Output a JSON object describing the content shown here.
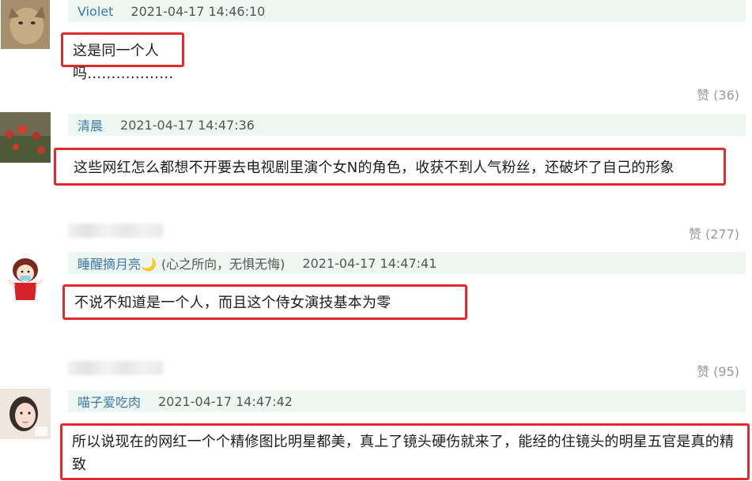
{
  "comments": [
    {
      "name": "Violet",
      "time": "2021-04-17 14:46:10",
      "text": "这是同一个人吗……………… ",
      "likes": "赞 (36)"
    },
    {
      "name": "清晨",
      "time": "2021-04-17 14:47:36",
      "text": "这些网红怎么都想不开要去电视剧里演个女N的角色，收获不到人气粉丝，还破坏了自己的形象",
      "likes": "赞 (277)"
    },
    {
      "name": "睡醒摘月亮🌙",
      "subtitle": "(心之所向，无惧无悔)",
      "time": "2021-04-17 14:47:41",
      "text": "不说不知道是一个人，而且这个侍女演技基本为零",
      "likes": "赞 (95)"
    },
    {
      "name": "喵子爱吃肉",
      "time": "2021-04-17 14:47:42",
      "text": "所以说现在的网红一个个精修图比明星都美，真上了镜头硬伤就来了，能经的住镜头的明星五官是真的精致"
    }
  ]
}
